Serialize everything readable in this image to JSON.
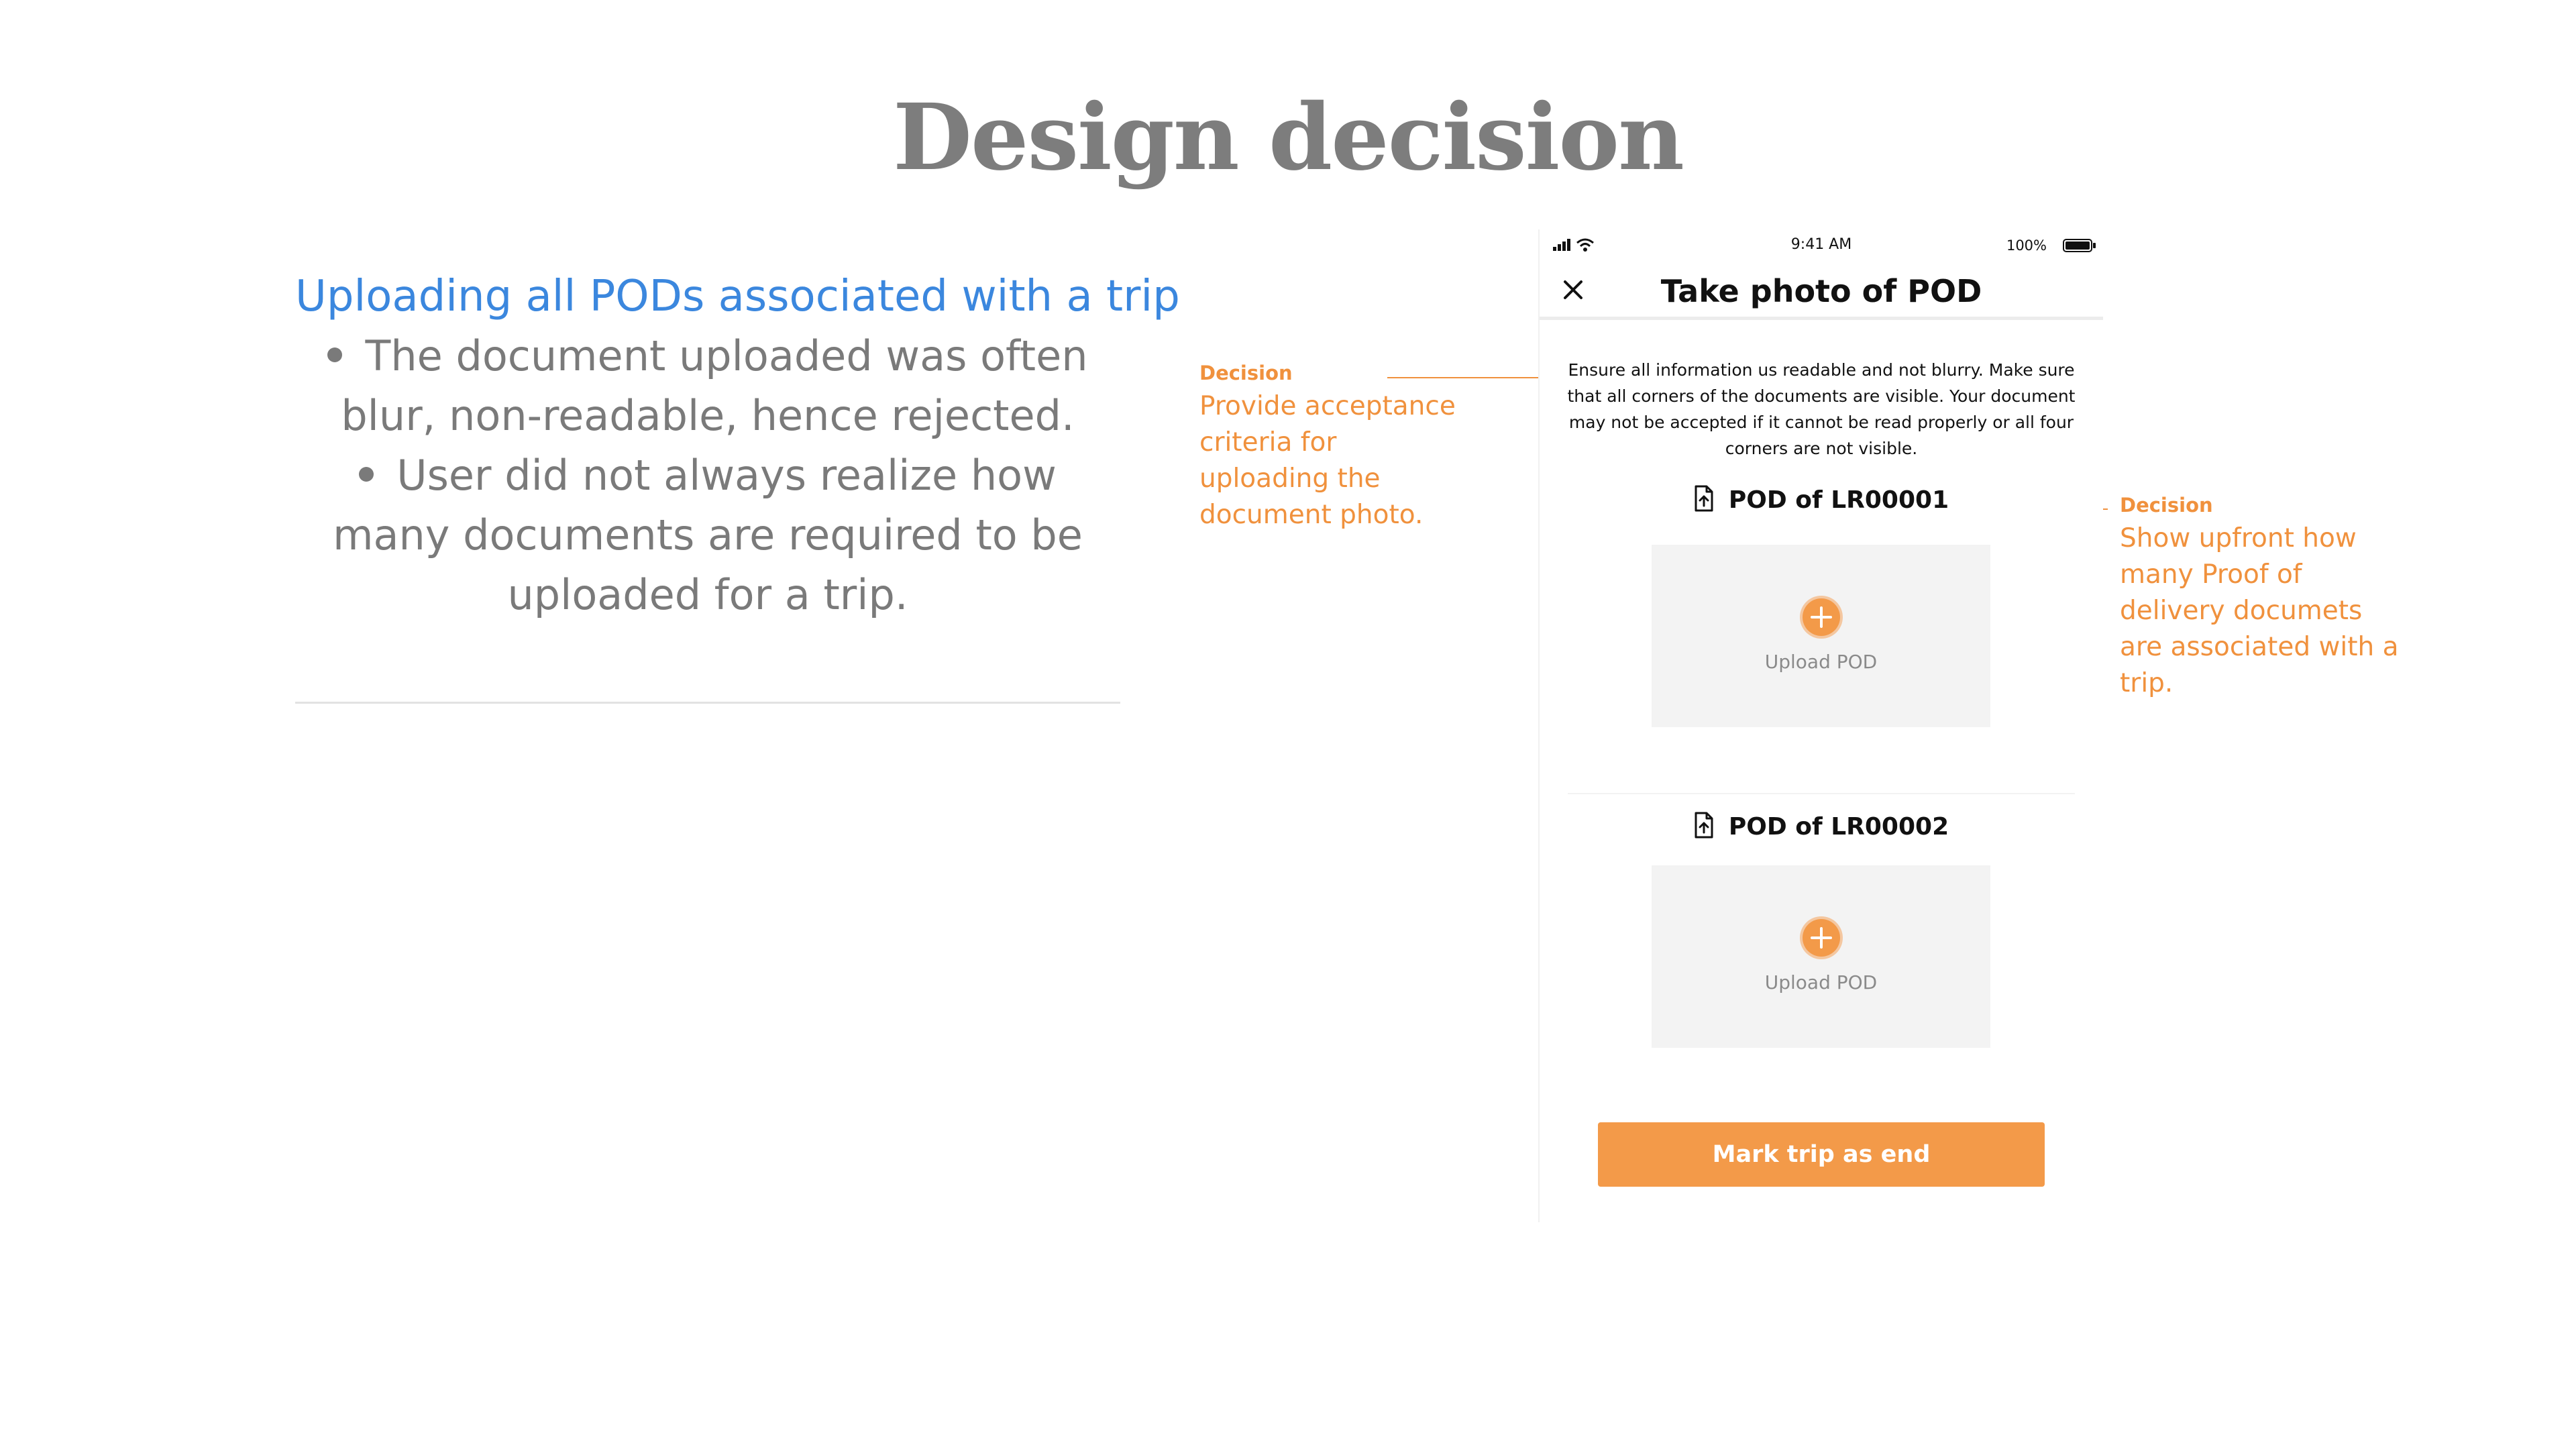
{
  "slide": {
    "title": "Design decision"
  },
  "problem": {
    "heading": "Uploading all PODs associated with a trip",
    "bullets": [
      "The document uploaded was often blur, non-readable, hence rejected.",
      "User did not always realize how many documents are required to be uploaded for a trip."
    ]
  },
  "annotations": {
    "left": {
      "label": "Decision",
      "text": "Provide acceptance\ncriteria for\nuploading the\ndocument photo."
    },
    "right": {
      "label": "Decision",
      "text": "Show upfront how\nmany Proof of\ndelivery documets\nare associated with a\ntrip."
    },
    "color": "#f0913d"
  },
  "phone": {
    "status_bar": {
      "time": "9:41 AM",
      "battery": "100%",
      "icons": [
        "signal-icon",
        "wifi-icon",
        "battery-icon"
      ]
    },
    "header": {
      "title": "Take photo of POD",
      "close_icon": "close-icon"
    },
    "instructions": "Ensure all information us readable and not blurry. Make sure that all corners of the documents are visible. Your document may not be accepted if it cannot be read properly or all four corners are not visible.",
    "pods": [
      {
        "title": "POD of LR00001",
        "upload_label": "Upload POD"
      },
      {
        "title": "POD of LR00002",
        "upload_label": "Upload POD"
      }
    ],
    "primary_button": "Mark trip as end",
    "accent_color": "#f39a49"
  }
}
